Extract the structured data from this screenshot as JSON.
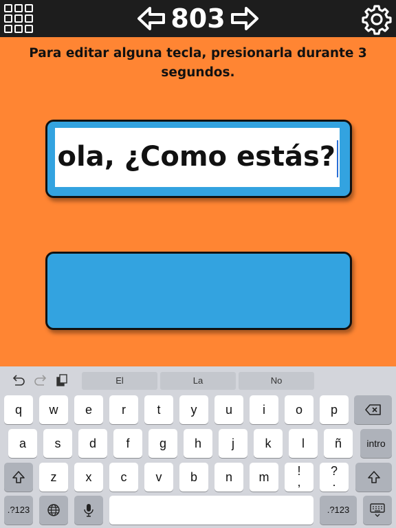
{
  "header": {
    "counter": "803",
    "menu_icon": "grid-icon",
    "back_icon": "arrow-left-icon",
    "forward_icon": "arrow-right-icon",
    "settings_icon": "gear-icon"
  },
  "instruction": "Para editar alguna tecla, presionarla durante 3 segundos.",
  "textbox": {
    "value": "Hola, ¿Como estás?"
  },
  "speak_button": {
    "label": ""
  },
  "keyboard": {
    "toolbar": [
      "undo-icon",
      "redo-icon",
      "paste-icon"
    ],
    "suggestions": [
      "El",
      "La",
      "No"
    ],
    "row1": [
      "q",
      "w",
      "e",
      "r",
      "t",
      "y",
      "u",
      "i",
      "o",
      "p"
    ],
    "row2": [
      "a",
      "s",
      "d",
      "f",
      "g",
      "h",
      "j",
      "k",
      "l",
      "ñ"
    ],
    "row3": [
      "z",
      "x",
      "c",
      "v",
      "b",
      "n",
      "m"
    ],
    "punct1_top": "!",
    "punct1_bottom": ",",
    "punct2_top": "?",
    "punct2_bottom": ".",
    "return_label": "intro",
    "numbers_label": ".?123",
    "space_label": ""
  }
}
